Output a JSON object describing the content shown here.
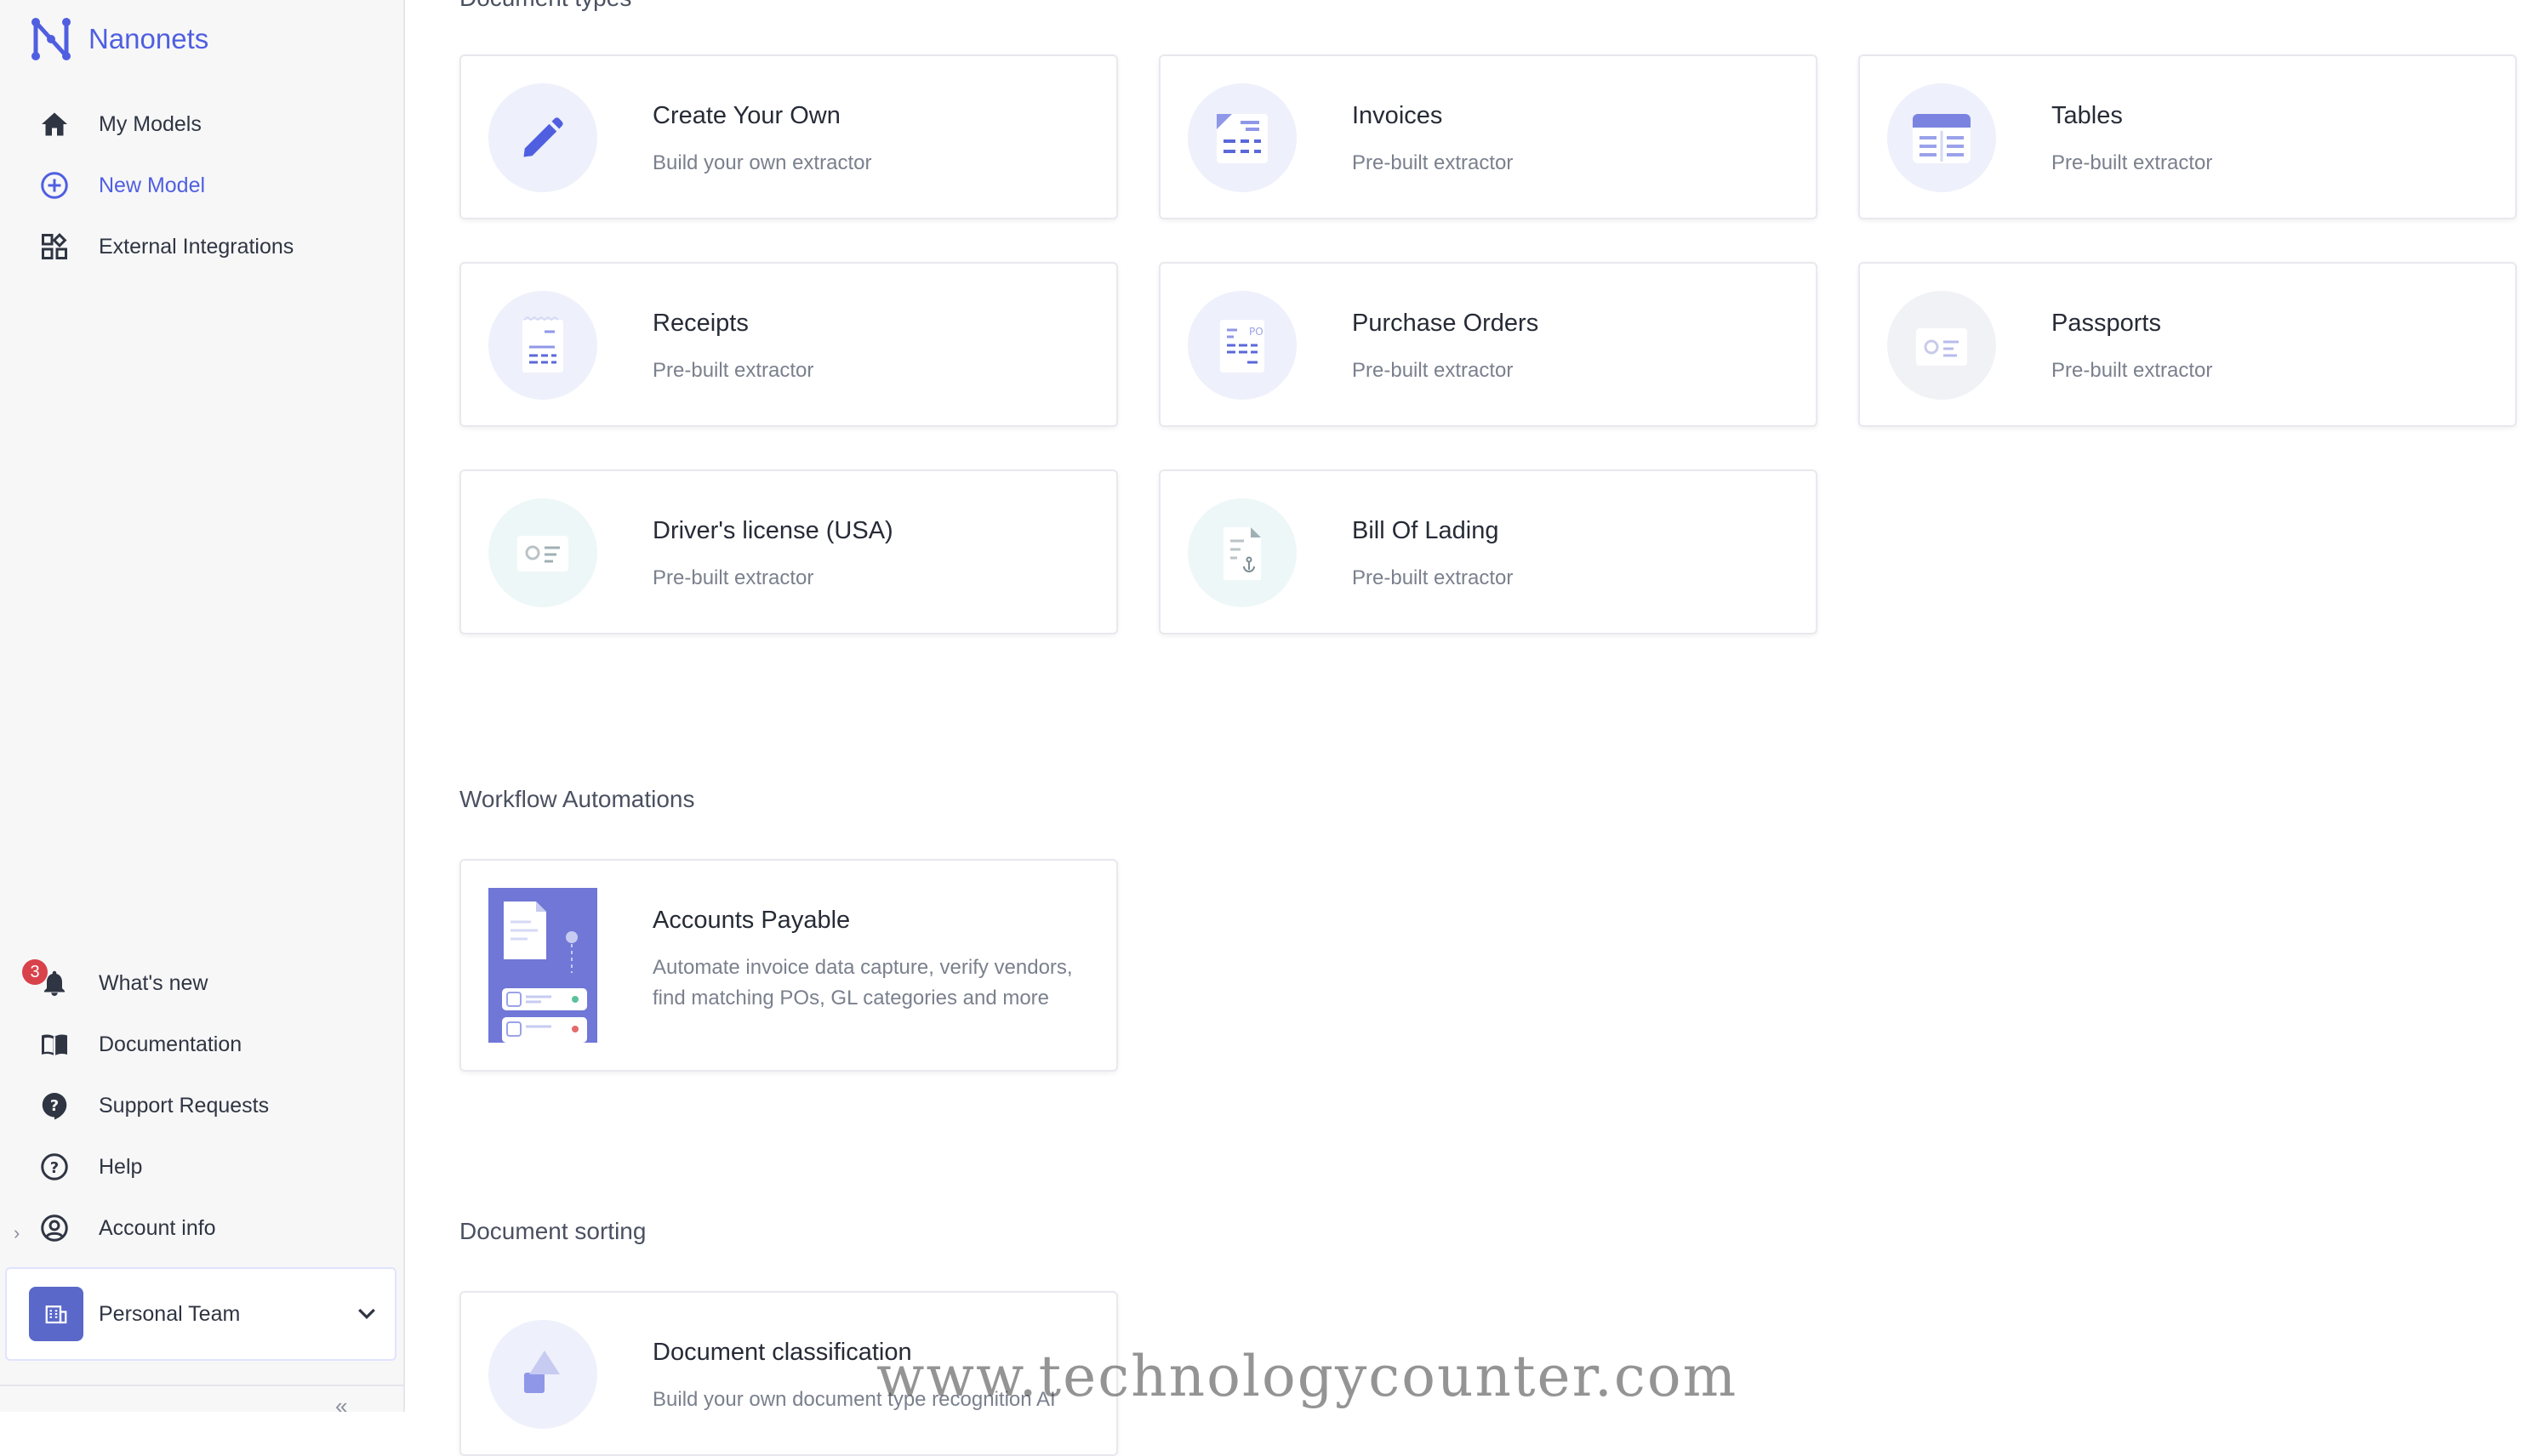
{
  "brand": {
    "name": "Nanonets"
  },
  "nav": {
    "top": [
      {
        "label": "My Models"
      },
      {
        "label": "New Model"
      },
      {
        "label": "External Integrations"
      }
    ],
    "bottom": [
      {
        "label": "What's new",
        "badge": "3"
      },
      {
        "label": "Documentation"
      },
      {
        "label": "Support Requests"
      },
      {
        "label": "Help"
      },
      {
        "label": "Account info"
      }
    ]
  },
  "team": {
    "label": "Personal Team"
  },
  "sections": {
    "document_types": {
      "title": "Document types",
      "cards": [
        {
          "title": "Create Your Own",
          "subtitle": "Build your own extractor"
        },
        {
          "title": "Invoices",
          "subtitle": "Pre-built extractor"
        },
        {
          "title": "Tables",
          "subtitle": "Pre-built extractor"
        },
        {
          "title": "Receipts",
          "subtitle": "Pre-built extractor"
        },
        {
          "title": "Purchase Orders",
          "subtitle": "Pre-built extractor"
        },
        {
          "title": "Passports",
          "subtitle": "Pre-built extractor"
        },
        {
          "title": "Driver's license (USA)",
          "subtitle": "Pre-built extractor"
        },
        {
          "title": "Bill Of Lading",
          "subtitle": "Pre-built extractor"
        }
      ]
    },
    "workflow": {
      "title": "Workflow Automations",
      "cards": [
        {
          "title": "Accounts Payable",
          "subtitle": "Automate invoice data capture, verify vendors, find matching POs, GL categories and more"
        }
      ]
    },
    "sorting": {
      "title": "Document sorting",
      "cards": [
        {
          "title": "Document classification",
          "subtitle": "Build your own document type recognition AI"
        }
      ]
    }
  },
  "watermark": "www.technologycounter.com",
  "colors": {
    "accent": "#4f5fe0",
    "badge": "#d8424a",
    "team_icon": "#5a68c9"
  }
}
